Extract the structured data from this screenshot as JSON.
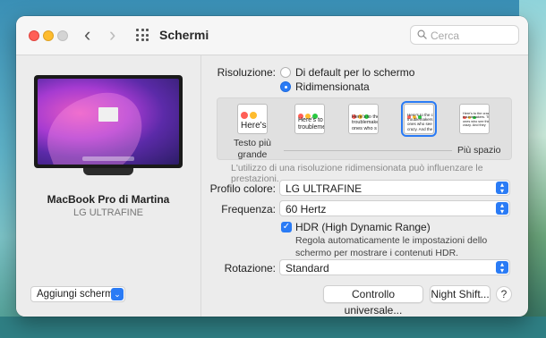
{
  "window": {
    "title": "Schermi"
  },
  "search": {
    "placeholder": "Cerca"
  },
  "display": {
    "device_name": "MacBook Pro di Martina",
    "monitor_name": "LG ULTRAFINE"
  },
  "add_screen": {
    "label": "Aggiungi schermo"
  },
  "resolution": {
    "label": "Risoluzione:",
    "options": [
      {
        "label": "Di default per lo schermo",
        "selected": false
      },
      {
        "label": "Ridimensionata",
        "selected": true
      }
    ],
    "scale_left": "Testo più grande",
    "scale_right": "Più spazio",
    "thumbs": [
      {
        "text": "Here's",
        "selected": false
      },
      {
        "text": "Here's to\ntroubleme",
        "selected": false
      },
      {
        "text": "Here's to the\ntroublemake\nones who s",
        "selected": false
      },
      {
        "text": "Here's to the cr\ntroublemakers\nones who see t\ncrazy. And the",
        "selected": true
      },
      {
        "text": "Here's to the crazy\ntroublemakers. Th\nones who see thin\ncrazy. And they",
        "selected": false
      }
    ],
    "hint": "L'utilizzo di una risoluzione ridimensionata può influenzare le prestazioni."
  },
  "color_profile": {
    "label": "Profilo colore:",
    "value": "LG ULTRAFINE"
  },
  "frequency": {
    "label": "Frequenza:",
    "value": "60 Hertz"
  },
  "hdr": {
    "label": "HDR (High Dynamic Range)",
    "checked": true,
    "description": "Regola automaticamente le impostazioni dello schermo per mostrare i contenuti HDR."
  },
  "rotation": {
    "label": "Rotazione:",
    "value": "Standard"
  },
  "buttons": {
    "universal_control": "Controllo universale...",
    "night_shift": "Night Shift...",
    "help": "?"
  },
  "colors": {
    "accent": "#2a7bf5",
    "red": "#ff5f57",
    "yellow": "#febc2e"
  }
}
